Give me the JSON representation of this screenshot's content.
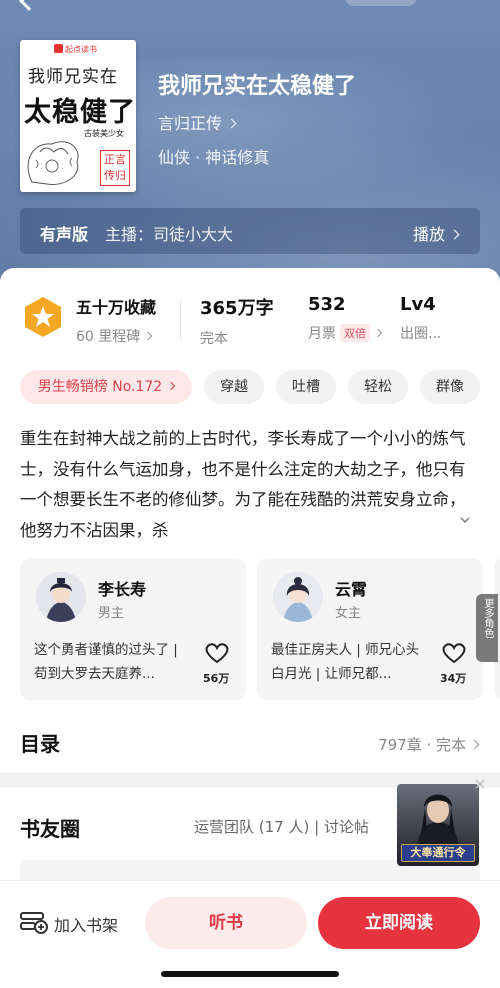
{
  "cover": {
    "brand": "起点读书",
    "line1": "我师兄实在",
    "line2": "太稳健了",
    "tagline": "古装美少女",
    "stamp_line1": "正言",
    "stamp_line2": "传归"
  },
  "book": {
    "title": "我师兄实在太稳健了",
    "author": "言归正传",
    "genre": "仙侠 · 神话修真"
  },
  "audio": {
    "label": "有声版",
    "host": "主播：司徒小大大",
    "play": "播放"
  },
  "stats": {
    "favorites": "五十万收藏",
    "milestones": "60 里程碑",
    "words": "365万字",
    "status": "完本",
    "votes": "532",
    "votes_label": "月票",
    "double": "双倍",
    "level": "Lv4",
    "level_label": "出圈..."
  },
  "tags": [
    "男生畅销榜 No.172",
    "穿越",
    "吐槽",
    "轻松",
    "群像"
  ],
  "description": "重生在封神大战之前的上古时代，李长寿成了一个小小的炼气士，没有什么气运加身，也不是什么注定的大劫之子，他只有一个想要长生不老的修仙梦。为了能在残酷的洪荒安身立命，他努力不沾因果，杀",
  "characters": [
    {
      "name": "李长寿",
      "role": "男主",
      "quote": "这个勇者谨慎的过头了 | 苟到大罗去天庭养...",
      "likes": "56万"
    },
    {
      "name": "云霄",
      "role": "女主",
      "quote": "最佳正房夫人 | 师兄心头白月光 | 让师兄都...",
      "likes": "34万"
    }
  ],
  "more_roles": "更多角色",
  "catalog": {
    "title": "目录",
    "info": "797章 · 完本"
  },
  "circle": {
    "title": "书友圈",
    "info": "运营团队 (17 人) | 讨论帖"
  },
  "ad": {
    "banner": "大奉通行令"
  },
  "bottom": {
    "shelf": "加入书架",
    "listen": "听书",
    "read": "立即阅读"
  },
  "colors": {
    "accent_red": "#e5343f",
    "hero_blue": "#6884ad",
    "badge_orange": "#f5a623"
  }
}
